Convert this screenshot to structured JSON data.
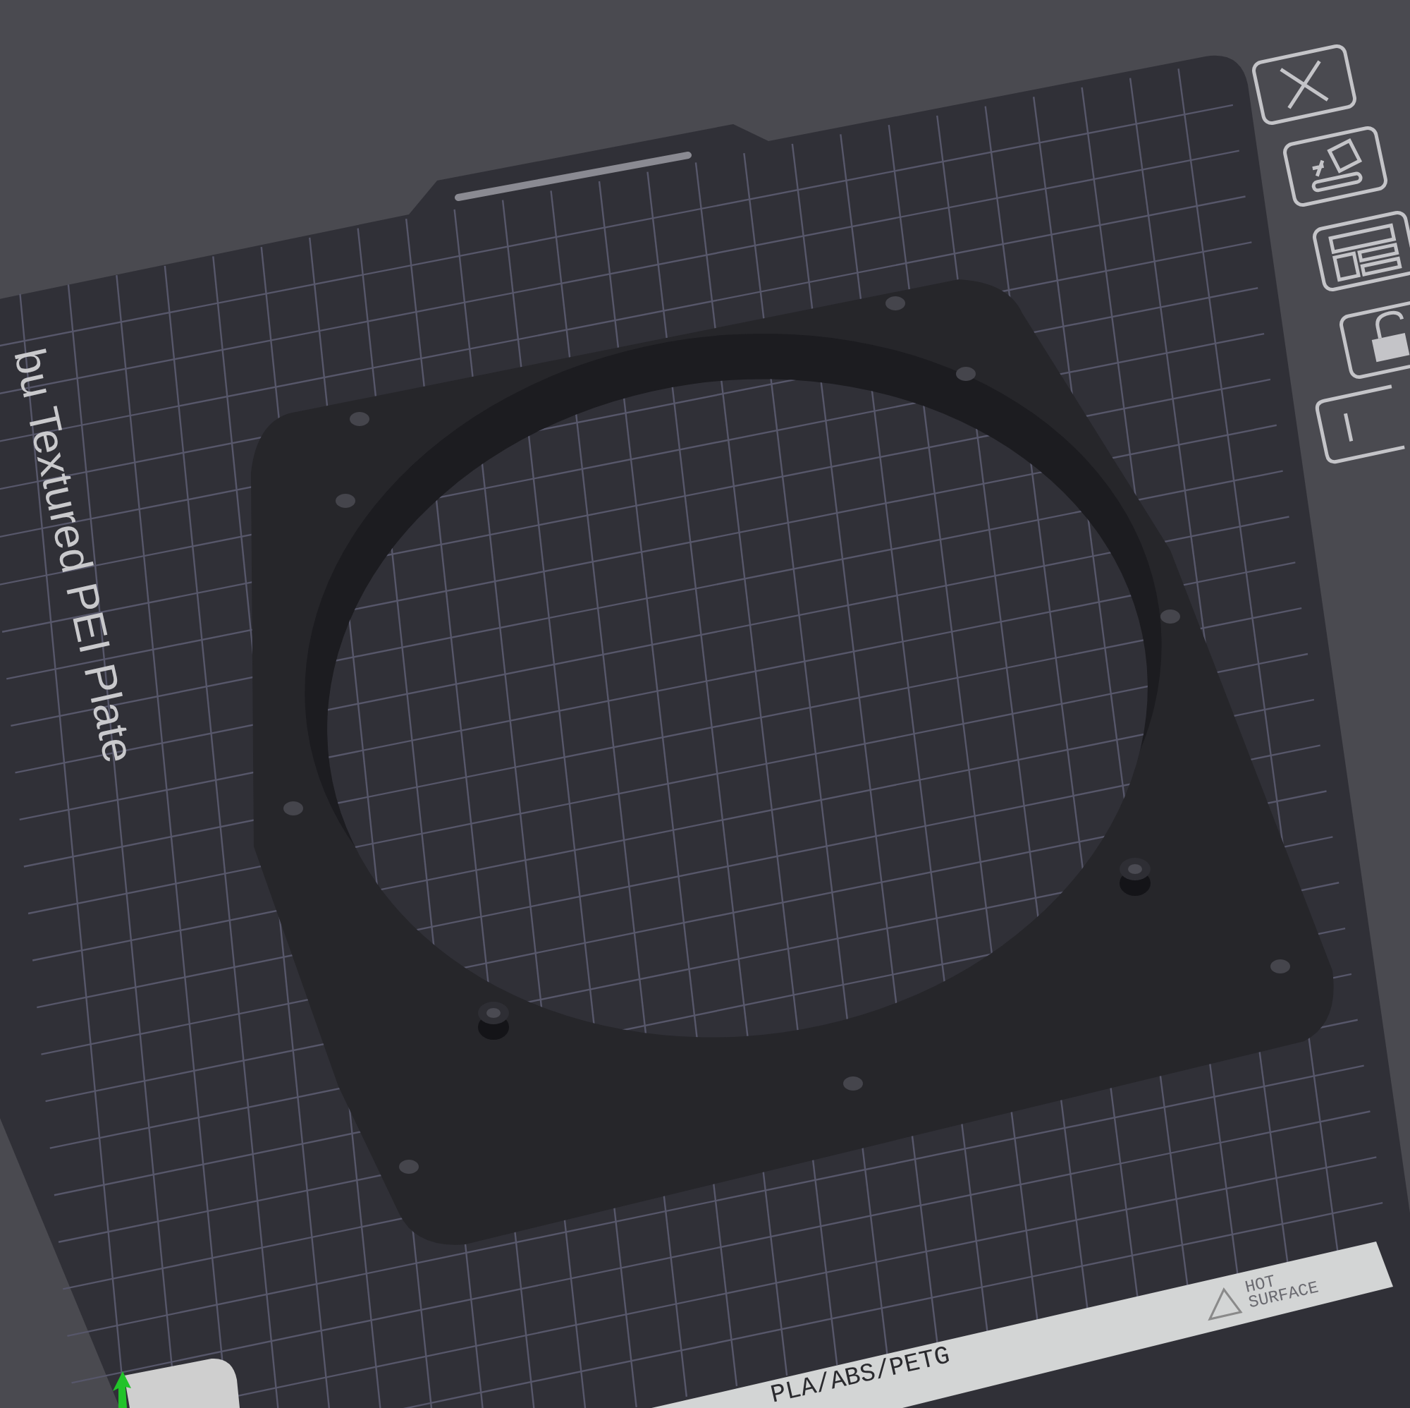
{
  "plate": {
    "name": "bu Textured PEI Plate",
    "materials": "PLA/ABS/PETG",
    "warning": [
      "HOT",
      "SURFACE"
    ]
  },
  "toolbar": [
    {
      "kind": "close"
    },
    {
      "kind": "arrange"
    },
    {
      "kind": "layout"
    },
    {
      "kind": "lock"
    },
    {
      "kind": "more"
    }
  ]
}
